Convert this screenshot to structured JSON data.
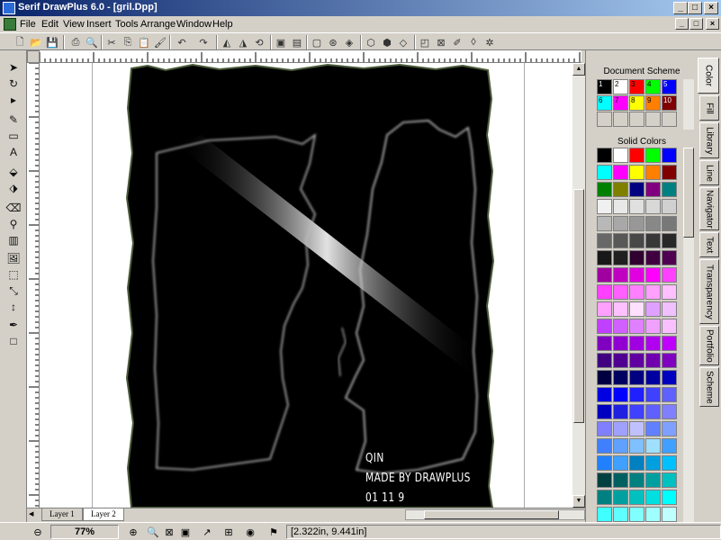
{
  "window": {
    "title": "Serif DrawPlus 6.0 - [gril.Dpp]",
    "controls": [
      "_",
      "□",
      "×"
    ]
  },
  "menu": [
    {
      "label": "File"
    },
    {
      "label": "Edit"
    },
    {
      "label": "View"
    },
    {
      "label": "Insert"
    },
    {
      "label": "Tools"
    },
    {
      "label": "Arrange"
    },
    {
      "label": "Window"
    },
    {
      "label": "Help"
    }
  ],
  "artwork": {
    "line1": "QIN",
    "line2": "MADE BY DRAWPLUS",
    "line3": "01 11 9"
  },
  "layers": {
    "tab1": "Layer 1",
    "tab2": "Layer 2"
  },
  "status": {
    "zoom": "77%",
    "coords": "[2.322in, 9.441in]"
  },
  "panel": {
    "doc_scheme_title": "Document Scheme",
    "solid_colors_title": "Solid Colors",
    "scheme_numbers": [
      "1",
      "2",
      "3",
      "4",
      "5",
      "6",
      "7",
      "8",
      "9",
      "10"
    ],
    "scheme_colors": [
      "#000000",
      "#ffffff",
      "#ff0000",
      "#00ff00",
      "#0000ff",
      "#00ffff",
      "#ff00ff",
      "#ffff00",
      "#ff8000",
      "#800000"
    ],
    "solid_colors": [
      "#000000",
      "#ffffff",
      "#ff0000",
      "#00ff00",
      "#0000ff",
      "#00ffff",
      "#ff00ff",
      "#ffff00",
      "#ff8000",
      "#800000",
      "#008000",
      "#808000",
      "#000080",
      "#800080",
      "#008080",
      "#f0f0f0",
      "#e8e8e8",
      "#e0e0e0",
      "#d8d8d8",
      "#d0d0d0",
      "#b8b8b8",
      "#a8a8a8",
      "#989898",
      "#888888",
      "#787878",
      "#686868",
      "#585858",
      "#484848",
      "#383838",
      "#282828",
      "#181818",
      "#202020",
      "#300030",
      "#400040",
      "#500050",
      "#a000a0",
      "#c000c0",
      "#e000e0",
      "#ff00ff",
      "#ff40ff",
      "#ff40ff",
      "#ff60ff",
      "#ff80ff",
      "#ffa0ff",
      "#ffc0ff",
      "#ffa0ff",
      "#ffc0ff",
      "#ffe0ff",
      "#e0a0ff",
      "#f0c0ff",
      "#c040ff",
      "#d060ff",
      "#e080ff",
      "#f0a0ff",
      "#f8c0ff",
      "#8000c0",
      "#9000d0",
      "#a000e0",
      "#b000f0",
      "#c000ff",
      "#400080",
      "#500090",
      "#6000a0",
      "#7000b0",
      "#8000c0",
      "#000040",
      "#000060",
      "#000080",
      "#0000a0",
      "#0000c0",
      "#0000e0",
      "#0000ff",
      "#2020ff",
      "#4040ff",
      "#6060ff",
      "#0000c0",
      "#2020e0",
      "#4040ff",
      "#6060ff",
      "#8080ff",
      "#8080ff",
      "#a0a0ff",
      "#c0c0ff",
      "#6080ff",
      "#80a0ff",
      "#4080ff",
      "#60a0ff",
      "#80c0ff",
      "#a0e0ff",
      "#40a0ff",
      "#2080ff",
      "#40a0ff",
      "#0080c0",
      "#00a0e0",
      "#00c0ff",
      "#004040",
      "#006060",
      "#008080",
      "#00a0a0",
      "#00c0c0",
      "#008080",
      "#00a0a0",
      "#00c0c0",
      "#00e0e0",
      "#00ffff",
      "#40ffff",
      "#60ffff",
      "#80ffff",
      "#a0ffff",
      "#c0ffff"
    ]
  },
  "side_tabs": [
    {
      "label": "Color"
    },
    {
      "label": "Fill"
    },
    {
      "label": "Library"
    },
    {
      "label": "Line"
    },
    {
      "label": "Navigator"
    },
    {
      "label": "Text"
    },
    {
      "label": "Transparency"
    },
    {
      "label": "Portfolio"
    },
    {
      "label": "Scheme"
    }
  ]
}
